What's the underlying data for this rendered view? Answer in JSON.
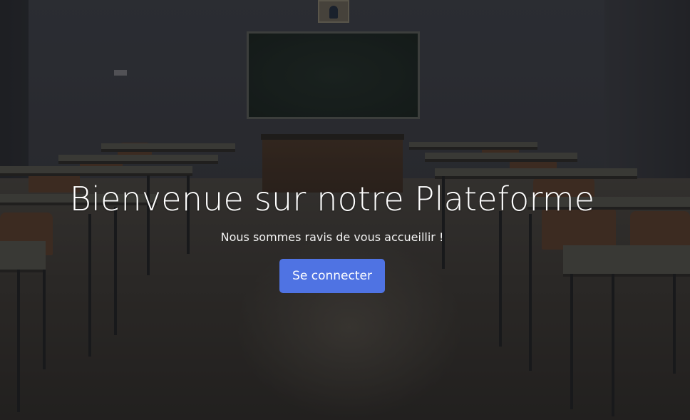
{
  "hero": {
    "title": "Bienvenue sur notre Plateforme",
    "subtitle": "Nous sommes ravis de vous accueillir !",
    "cta_label": "Se connecter",
    "accent_color": "#4f73e3",
    "background_icon": "classroom-background-image"
  }
}
